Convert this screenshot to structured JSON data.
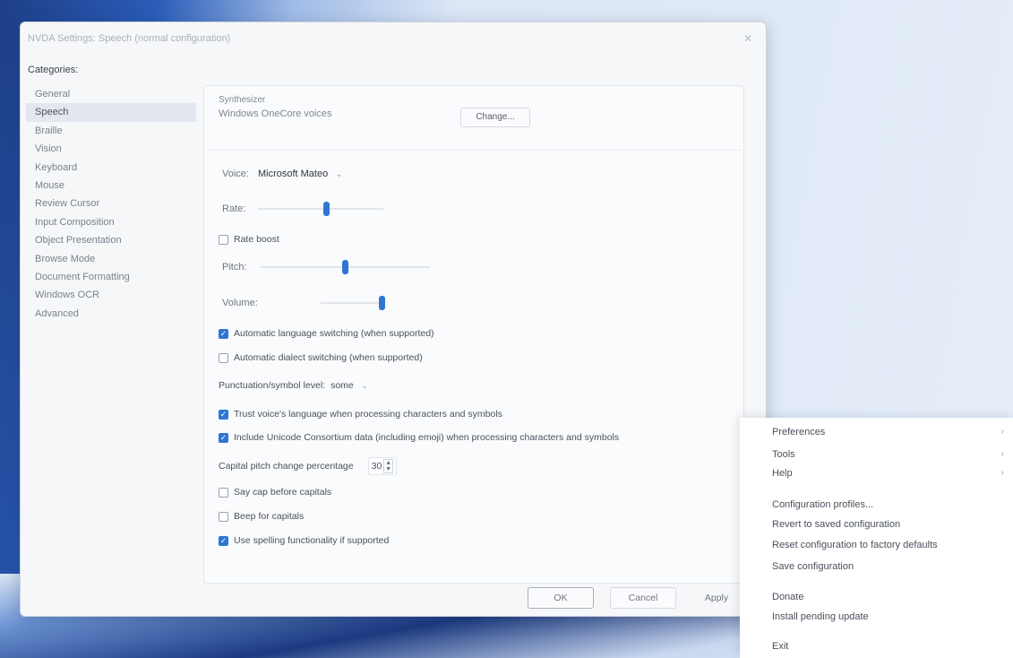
{
  "dialog": {
    "title": "NVDA Settings: Speech (normal configuration)",
    "close_icon": "close-icon",
    "categories_label": "Categories:",
    "categories": [
      "General",
      "Speech",
      "Braille",
      "Vision",
      "Keyboard",
      "Mouse",
      "Review Cursor",
      "Input Composition",
      "Object Presentation",
      "Browse Mode",
      "Document Formatting",
      "Windows OCR",
      "Advanced"
    ],
    "selected_category": "Speech"
  },
  "speech": {
    "synthesizer_label": "Synthesizer",
    "synthesizer_value": "Windows OneCore voices",
    "change_button": "Change...",
    "voice_label": "Voice:",
    "voice_value": "Microsoft Mateo",
    "rate_label": "Rate:",
    "rate_value": 0.55,
    "rate_boost_label": "Rate boost",
    "rate_boost_checked": false,
    "pitch_label": "Pitch:",
    "pitch_value": 0.5,
    "volume_label": "Volume:",
    "volume_value": 1.0,
    "auto_language_label": "Automatic language switching (when supported)",
    "auto_language_checked": true,
    "auto_dialect_label": "Automatic dialect switching (when supported)",
    "auto_dialect_checked": false,
    "punctuation_label": "Punctuation/symbol level:",
    "punctuation_value": "some",
    "trust_voice_label": "Trust voice's language when processing characters and symbols",
    "trust_voice_checked": true,
    "unicode_label": "Include Unicode Consortium data (including emoji) when processing characters and symbols",
    "unicode_checked": true,
    "cap_pitch_label": "Capital pitch change percentage",
    "cap_pitch_value": "30",
    "say_cap_label": "Say cap before capitals",
    "say_cap_checked": false,
    "beep_label": "Beep for capitals",
    "beep_checked": false,
    "spelling_label": "Use spelling functionality if supported",
    "spelling_checked": true
  },
  "footer": {
    "ok": "OK",
    "cancel": "Cancel",
    "apply": "Apply"
  },
  "menu": {
    "items": [
      {
        "label": "Preferences",
        "submenu": true
      },
      {
        "label": "Tools",
        "submenu": true
      },
      {
        "label": "Help",
        "submenu": true
      },
      {
        "label": "Configuration profiles..."
      },
      {
        "label": "Revert to saved configuration"
      },
      {
        "label": "Reset configuration to factory defaults"
      },
      {
        "label": "Save configuration"
      },
      {
        "label": "Donate"
      },
      {
        "label": "Install pending update"
      },
      {
        "label": "Exit"
      }
    ],
    "submenu_glyph": "›"
  },
  "colors": {
    "accent": "#2f76d3"
  }
}
